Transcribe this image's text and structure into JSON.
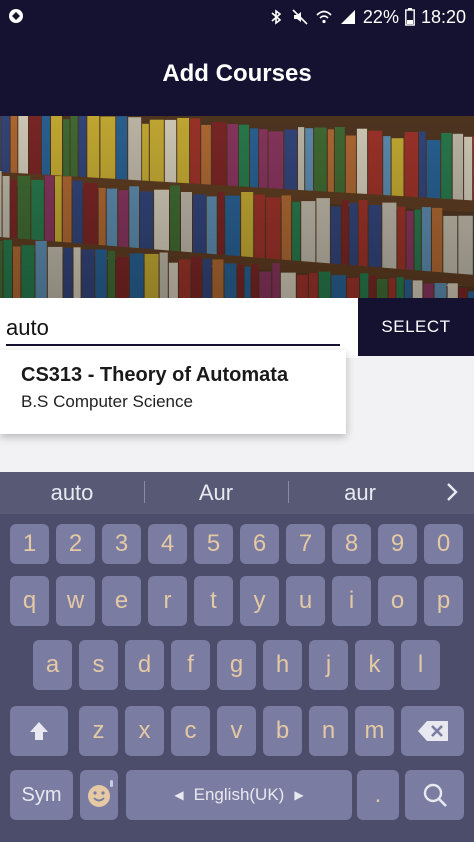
{
  "status": {
    "battery": "22%",
    "time": "18:20"
  },
  "app_bar": {
    "title": "Add Courses"
  },
  "search": {
    "value": "auto",
    "select_label": "SELECT"
  },
  "suggestion": {
    "title": "CS313 - Theory of Automata",
    "subtitle": "B.S Computer Science"
  },
  "keyboard": {
    "predictions": [
      "auto",
      "Aur",
      "aur"
    ],
    "row_numbers": [
      "1",
      "2",
      "3",
      "4",
      "5",
      "6",
      "7",
      "8",
      "9",
      "0"
    ],
    "row_top": [
      "q",
      "w",
      "e",
      "r",
      "t",
      "y",
      "u",
      "i",
      "o",
      "p"
    ],
    "row_mid": [
      "a",
      "s",
      "d",
      "f",
      "g",
      "h",
      "j",
      "k",
      "l"
    ],
    "row_bottom": [
      "z",
      "x",
      "c",
      "v",
      "b",
      "n",
      "m"
    ],
    "sym_label": "Sym",
    "space_label": "English(UK)",
    "period_label": "."
  },
  "colors": {
    "primary": "#141230",
    "key_bg": "#7a7ca1",
    "key_text": "#e4c9a4",
    "keyboard_bg": "#4b4d6a"
  }
}
